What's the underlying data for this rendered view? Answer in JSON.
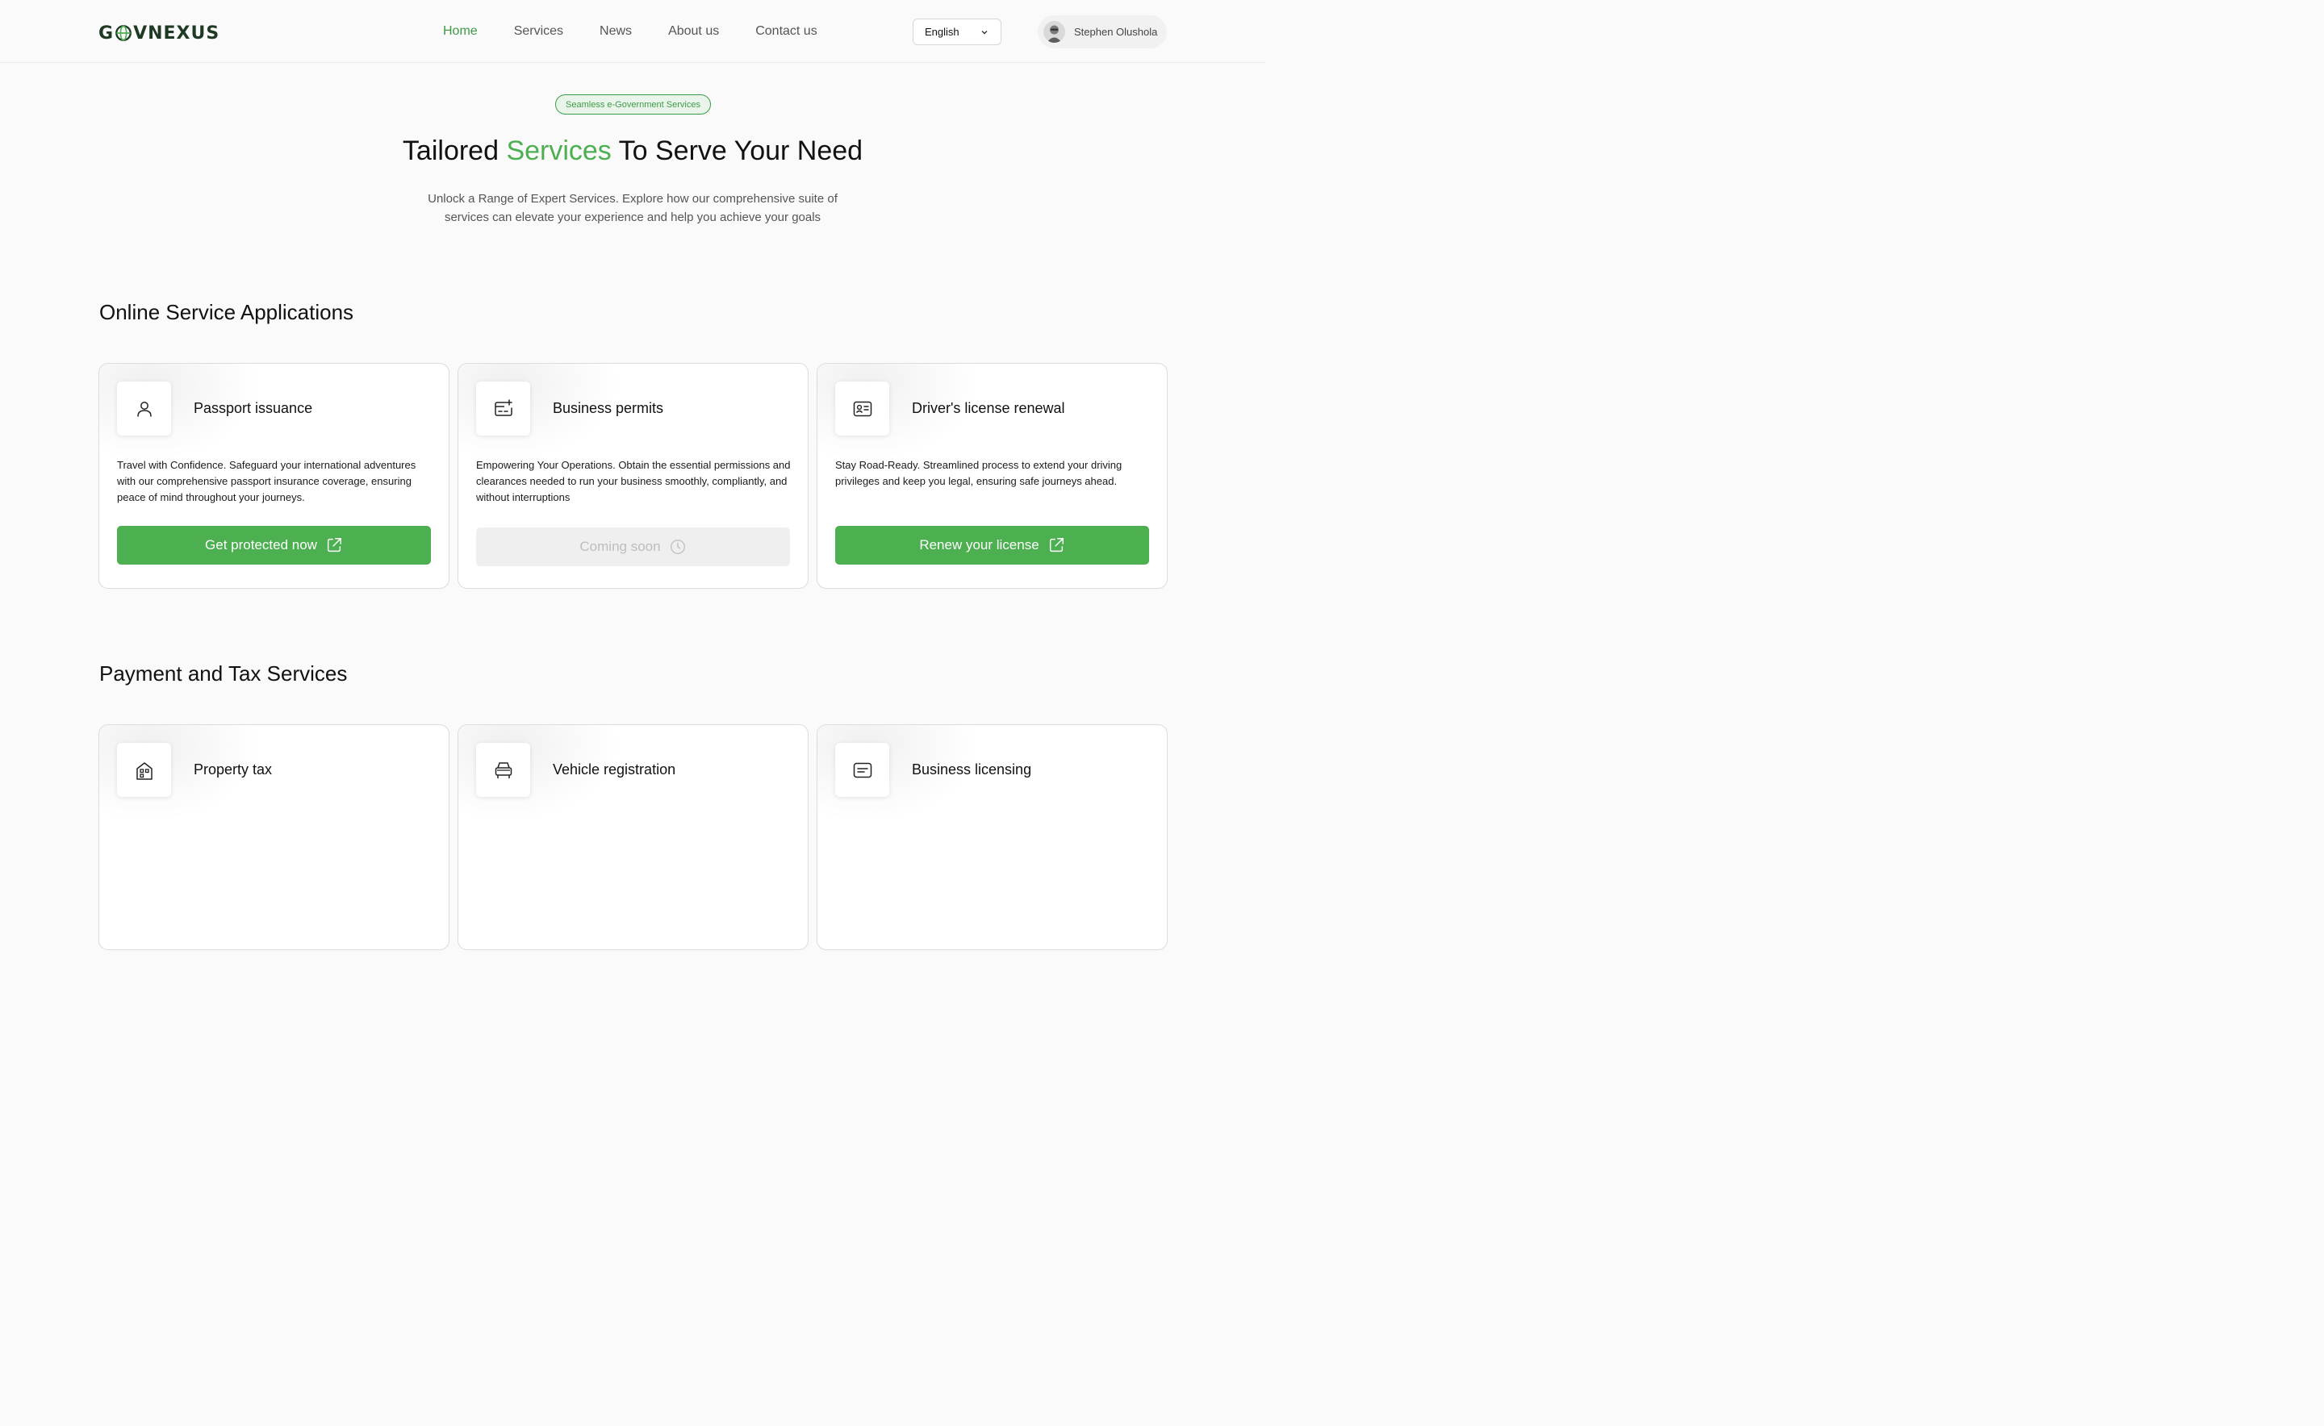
{
  "brand": {
    "logo_text_left": "G",
    "logo_text_right": "VNEXUS"
  },
  "nav": {
    "items": [
      {
        "label": "Home",
        "active": true
      },
      {
        "label": "Services",
        "active": false
      },
      {
        "label": "News",
        "active": false
      },
      {
        "label": "About us",
        "active": false
      },
      {
        "label": "Contact us",
        "active": false
      }
    ]
  },
  "language": {
    "selected": "English"
  },
  "user": {
    "name": "Stephen Olushola"
  },
  "hero": {
    "badge": "Seamless e-Government Services",
    "title_before": "Tailored ",
    "title_accent": "Services",
    "title_after": " To Serve Your Need",
    "subtitle_line1": "Unlock a Range of Expert Services. Explore how our comprehensive suite of",
    "subtitle_line2": "services can elevate your experience and help you achieve your goals"
  },
  "sections": [
    {
      "title": "Online Service Applications",
      "cards": [
        {
          "icon": "user-icon",
          "title": "Passport issuance",
          "description": "Travel with Confidence. Safeguard your international adventures with our comprehensive passport insurance coverage, ensuring peace of mind throughout your journeys.",
          "button": "Get protected now",
          "button_icon": "external-link-icon",
          "disabled": false
        },
        {
          "icon": "permit-icon",
          "title": "Business permits",
          "description": "Empowering Your Operations. Obtain the essential permissions and clearances needed to run your business smoothly, compliantly, and without interruptions",
          "button": "Coming soon",
          "button_icon": "clock-icon",
          "disabled": true
        },
        {
          "icon": "id-card-icon",
          "title": "Driver's license renewal",
          "description": "Stay Road-Ready. Streamlined process to extend your driving privileges and keep you legal, ensuring safe journeys ahead.",
          "button": "Renew your license",
          "button_icon": "external-link-icon",
          "disabled": false
        }
      ]
    },
    {
      "title": "Payment and Tax Services",
      "cards": [
        {
          "icon": "house-icon",
          "title": "Property tax"
        },
        {
          "icon": "car-icon",
          "title": "Vehicle registration"
        },
        {
          "icon": "license-icon",
          "title": "Business licensing"
        }
      ]
    }
  ],
  "colors": {
    "accent": "#4caf50",
    "accent_dark": "#3d9b46",
    "background": "#fafafa"
  }
}
